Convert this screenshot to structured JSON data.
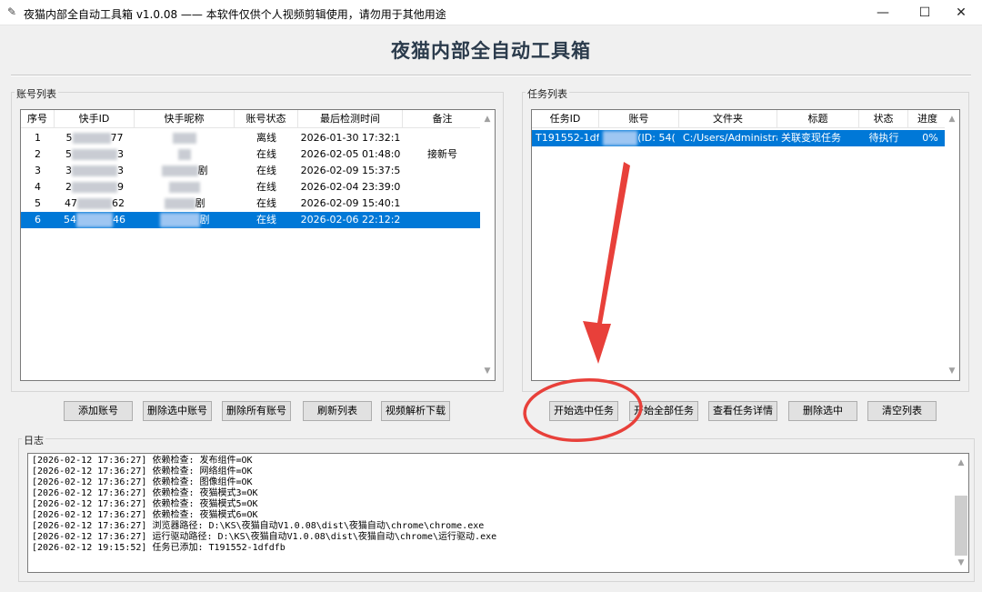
{
  "window": {
    "title": "夜猫内部全自动工具箱 v1.0.08 —— 本软件仅供个人视频剪辑使用，请勿用于其他用途",
    "minimize": "—",
    "maximize": "☐",
    "close": "✕"
  },
  "header": {
    "title": "夜猫内部全自动工具箱"
  },
  "accounts": {
    "group_label": "账号列表",
    "columns": [
      "序号",
      "快手ID",
      "快手昵称",
      "账号状态",
      "最后检测时间",
      "备注"
    ],
    "rows": [
      {
        "index": "1",
        "id_prefix": "5",
        "id_suffix": "77",
        "nick_suffix": "",
        "status": "离线",
        "time": "2026-01-30 17:32:1",
        "note": ""
      },
      {
        "index": "2",
        "id_prefix": "5",
        "id_suffix": "3",
        "nick_suffix": "",
        "status": "在线",
        "time": "2026-02-05 01:48:0",
        "note": "接新号"
      },
      {
        "index": "3",
        "id_prefix": "3",
        "id_suffix": "3",
        "nick_suffix": "剧",
        "status": "在线",
        "time": "2026-02-09 15:37:5",
        "note": ""
      },
      {
        "index": "4",
        "id_prefix": "2",
        "id_suffix": "9",
        "nick_suffix": "",
        "status": "在线",
        "time": "2026-02-04 23:39:0",
        "note": ""
      },
      {
        "index": "5",
        "id_prefix": "47",
        "id_suffix": "62",
        "nick_suffix": "剧",
        "status": "在线",
        "time": "2026-02-09 15:40:1",
        "note": ""
      },
      {
        "index": "6",
        "id_prefix": "54",
        "id_suffix": "46",
        "nick_suffix": "剧",
        "status": "在线",
        "time": "2026-02-06 22:12:2",
        "note": ""
      }
    ],
    "selected_row": 5,
    "buttons": [
      "添加账号",
      "删除选中账号",
      "删除所有账号",
      "刷新列表",
      "视频解析下载"
    ]
  },
  "tasks": {
    "group_label": "任务列表",
    "columns": [
      "任务ID",
      "账号",
      "文件夹",
      "标题",
      "状态",
      "进度"
    ],
    "rows": [
      {
        "task_id": "T191552-1df",
        "account_suffix": "(ID: 54(",
        "folder": "C:/Users/Administra",
        "title": "关联变现任务",
        "status": "待执行",
        "progress": "0%"
      }
    ],
    "buttons": [
      "开始选中任务",
      "开始全部任务",
      "查看任务详情",
      "删除选中",
      "清空列表"
    ]
  },
  "log": {
    "group_label": "日志",
    "lines": [
      "[2026-02-12 17:36:27] 依赖检查: 发布组件=OK",
      "[2026-02-12 17:36:27] 依赖检查: 网络组件=OK",
      "[2026-02-12 17:36:27] 依赖检查: 图像组件=OK",
      "[2026-02-12 17:36:27] 依赖检查: 夜猫模式3=OK",
      "[2026-02-12 17:36:27] 依赖检查: 夜猫模式5=OK",
      "[2026-02-12 17:36:27] 依赖检查: 夜猫模式6=OK",
      "[2026-02-12 17:36:27] 浏览器路径: D:\\KS\\夜猫自动V1.0.08\\dist\\夜猫自动\\chrome\\chrome.exe",
      "[2026-02-12 17:36:27] 运行驱动路径: D:\\KS\\夜猫自动V1.0.08\\dist\\夜猫自动\\chrome\\运行驱动.exe",
      "[2026-02-12 19:15:52] 任务已添加: T191552-1dfdfb"
    ]
  },
  "scroll": {
    "up": "▲",
    "down": "▼"
  },
  "colors": {
    "selection": "#0078d7",
    "annotation": "#e8403a",
    "title": "#2b3b4c"
  }
}
